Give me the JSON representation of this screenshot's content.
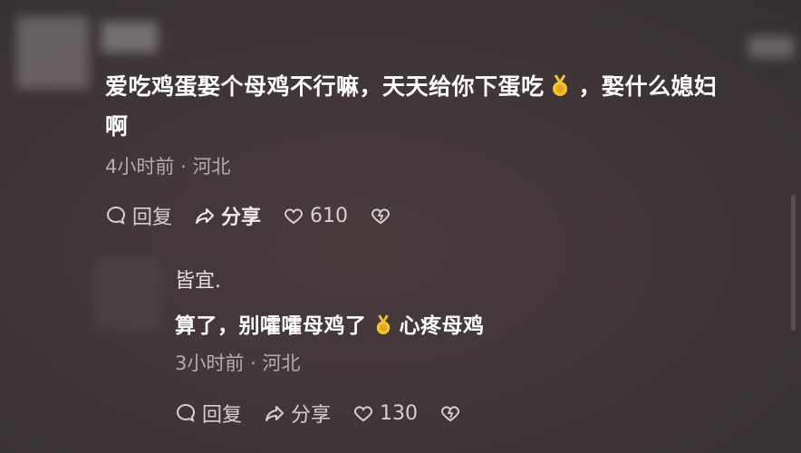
{
  "comment": {
    "text_line1_a": "爱吃鸡蛋娶个母鸡不行嘛，天天给你下蛋吃",
    "text_line1_b": "，娶什么媳妇",
    "text_line2": "啊",
    "emoji": "medal-emoji",
    "time": "4小时前",
    "separator": "·",
    "location": "河北",
    "reply_label": "回复",
    "share_label": "分享",
    "like_count": "610"
  },
  "reply": {
    "author": "皆宜.",
    "text_a": "算了，别嚯嚯母鸡了",
    "text_b": "心疼母鸡",
    "time": "3小时前",
    "separator": "·",
    "location": "河北",
    "reply_label": "回复",
    "share_label": "分享",
    "like_count": "130"
  },
  "colors": {
    "background": "#3f3537",
    "text": "#ffffff",
    "meta": "#b4acad",
    "emoji_gold": "#f2c230"
  }
}
